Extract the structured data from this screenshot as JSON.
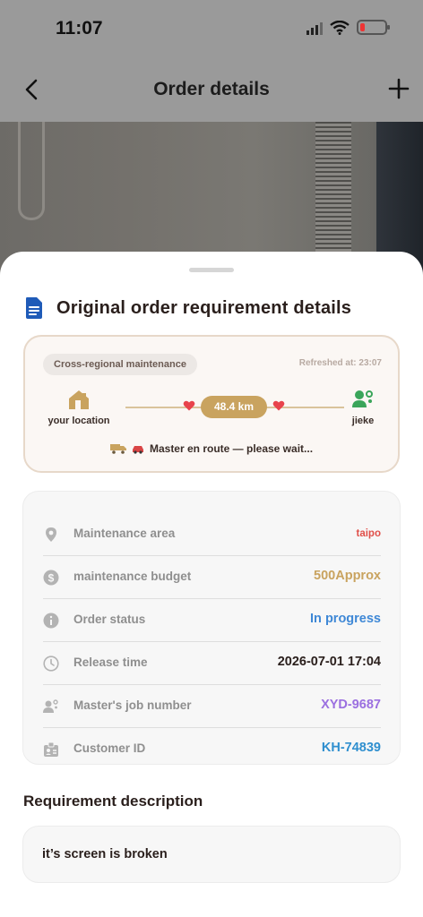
{
  "status_bar": {
    "time": "11:07"
  },
  "header": {
    "title": "Order details"
  },
  "section": {
    "title": "Original order requirement details"
  },
  "route": {
    "tag": "Cross-regional maintenance",
    "refreshed": "Refreshed at: 23:07",
    "from_label": "your location",
    "to_label": "jieke",
    "distance": "48.4 km",
    "status": "Master en route — please wait..."
  },
  "info_rows": [
    {
      "icon": "location-pin-icon",
      "label": "Maintenance area",
      "value": "taipo",
      "color": "#e0504a"
    },
    {
      "icon": "dollar-coin-icon",
      "label": "maintenance budget",
      "value": "500Approx",
      "color": "#c9a35f"
    },
    {
      "icon": "info-icon",
      "label": "Order status",
      "value": "In progress",
      "color": "#3f88d6"
    },
    {
      "icon": "clock-icon",
      "label": "Release time",
      "value": "2026-07-01 17:04",
      "color": "#2a1f1c"
    },
    {
      "icon": "worker-icon",
      "label": "Master's job number",
      "value": "XYD-9687",
      "color": "#9b6fe0"
    },
    {
      "icon": "id-badge-icon",
      "label": "Customer ID",
      "value": "KH-74839",
      "color": "#2f8fcf"
    }
  ],
  "requirement": {
    "title": "Requirement description",
    "text": "it’s screen is broken"
  }
}
